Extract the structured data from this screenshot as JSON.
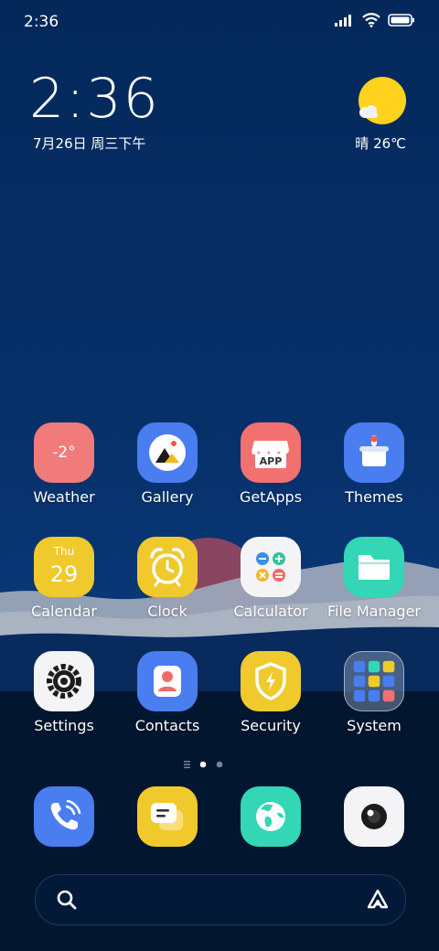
{
  "status": {
    "time": "2:36"
  },
  "widget": {
    "time": "2:36",
    "date": "7月26日 周三下午",
    "weather": "晴 26℃"
  },
  "apps": [
    {
      "label": "Weather",
      "icon": "weather-icon",
      "badge": "-2°"
    },
    {
      "label": "Gallery",
      "icon": "gallery-icon"
    },
    {
      "label": "GetApps",
      "icon": "getapps-icon",
      "badge": "APP"
    },
    {
      "label": "Themes",
      "icon": "themes-icon"
    },
    {
      "label": "Calendar",
      "icon": "calendar-icon",
      "day": "Thu",
      "date": "29"
    },
    {
      "label": "Clock",
      "icon": "clock-icon"
    },
    {
      "label": "Calculator",
      "icon": "calculator-icon"
    },
    {
      "label": "File Manager",
      "icon": "folder-icon"
    },
    {
      "label": "Settings",
      "icon": "gear-icon"
    },
    {
      "label": "Contacts",
      "icon": "contacts-icon"
    },
    {
      "label": "Security",
      "icon": "shield-icon"
    },
    {
      "label": "System",
      "icon": "folder-grid-icon"
    }
  ],
  "dock": [
    {
      "icon": "phone-icon"
    },
    {
      "icon": "messages-icon"
    },
    {
      "icon": "browser-icon"
    },
    {
      "icon": "camera-icon"
    }
  ],
  "page_indicator": {
    "pages": 2,
    "current": 1
  },
  "colors": {
    "wallpaper_top": "#04285c",
    "wallpaper_bottom": "#02152e",
    "accent_yellow": "#f0c92d"
  }
}
